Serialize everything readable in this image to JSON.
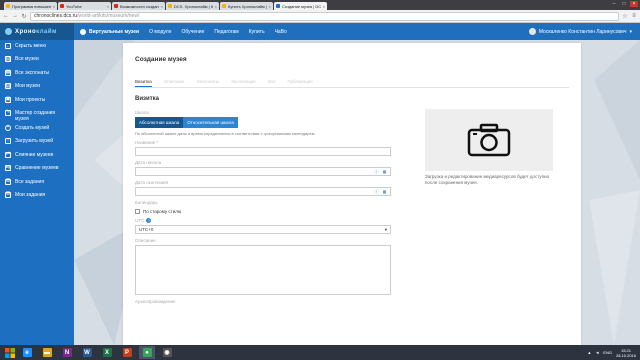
{
  "browser": {
    "tabs": [
      {
        "title": "Программа повышения к",
        "color": "#f4b400",
        "active": false
      },
      {
        "title": "YouTube",
        "color": "#e62117",
        "active": false
      },
      {
        "title": "Возможности создани",
        "color": "#e62117",
        "active": false
      },
      {
        "title": "DCS. Хроноклайм | К",
        "color": "#f4b400",
        "active": false
      },
      {
        "title": "Купить Хроноклайм |",
        "color": "#f4b400",
        "active": false
      },
      {
        "title": "Создание музея | DCS",
        "color": "#1f6fbd",
        "active": true
      }
    ],
    "url_host": "chronoclines.dcs.ru",
    "url_path": "/world-art/kits/museum/new/"
  },
  "header": {
    "logo_main": "Хроно",
    "logo_dim": "клайм",
    "nav": [
      "Виртуальные музеи",
      "О модуле",
      "Обучение",
      "Педагогам",
      "Купить",
      "ЧаВо"
    ],
    "user": "Москаленко Константин Ларинусович"
  },
  "sidebar": {
    "items": [
      {
        "label": "Скрыть меню",
        "icon": "←"
      },
      {
        "label": "Все музеи",
        "icon": "▤"
      },
      {
        "label": "Все экспонаты",
        "icon": "▦"
      },
      {
        "label": "Мои музеи",
        "icon": "▤"
      },
      {
        "label": "Мои проекты",
        "icon": "▣"
      },
      {
        "label": "Мастер создания музея",
        "icon": "✎"
      },
      {
        "label": "Создать музей",
        "icon": "+"
      },
      {
        "label": "Загрузить музей",
        "icon": "↑"
      },
      {
        "label": "Слияние музеев",
        "icon": "⇄"
      },
      {
        "label": "Сравнение музеев",
        "icon": "⇆"
      },
      {
        "label": "Все задания",
        "icon": "☰"
      },
      {
        "label": "Мои задания",
        "icon": "☰"
      }
    ]
  },
  "page": {
    "title": "Создание музея",
    "wizard_steps": [
      "Визитка",
      "Описание",
      "Экспонаты",
      "Экспозиция",
      "Зал",
      "Публикация"
    ],
    "section_title": "Визитка",
    "scale_label": "Шкала",
    "scale_on": "Абсолютная шкала",
    "scale_off": "Относительная шкала",
    "scale_hint": "По абсолютной шкале даты и время определяются в соответствии с григорианским календарем.",
    "name_label": "Название *",
    "start_label": "Дата начала",
    "end_label": "Дата окончания",
    "calendar_label": "Календарь",
    "old_style_label": "По старому стилю",
    "utc_label": "UTC",
    "utc_value": "UTC+0",
    "description_label": "Описание",
    "next_label": "Археопровождение",
    "media_note": "Загрузка и редактирование медиаресурсов будет доступна после сохранения музея."
  },
  "taskbar": {
    "apps": [
      {
        "name": "internet-explorer",
        "glyph": "e",
        "color": "#1e90ff"
      },
      {
        "name": "file-explorer",
        "glyph": "▬",
        "color": "#e0a526"
      },
      {
        "name": "onenote",
        "glyph": "N",
        "color": "#7b2a8c"
      },
      {
        "name": "word",
        "glyph": "W",
        "color": "#2b5797"
      },
      {
        "name": "excel",
        "glyph": "X",
        "color": "#1e7145"
      },
      {
        "name": "powerpoint",
        "glyph": "P",
        "color": "#c43e1c"
      },
      {
        "name": "chrome",
        "glyph": "●",
        "color": "#3aa55a"
      },
      {
        "name": "media",
        "glyph": "◉",
        "color": "#555555"
      }
    ],
    "lang": "ENG",
    "time": "15:21",
    "date": "28.10.2016"
  }
}
